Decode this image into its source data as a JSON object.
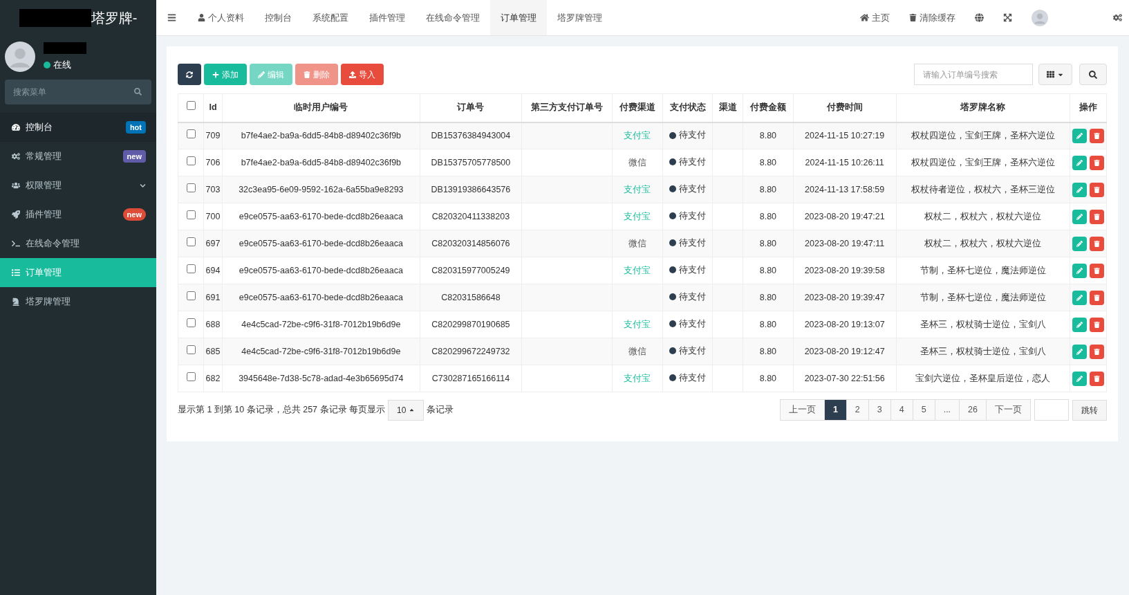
{
  "sidebar": {
    "logo_text": "塔罗牌-",
    "user_status": "在线",
    "search": {
      "placeholder": "搜索菜单"
    },
    "items": [
      {
        "label": "控制台",
        "selected": false,
        "badge": {
          "text": "hot",
          "color": "#0073b7",
          "kind": "square"
        }
      },
      {
        "label": "常规管理",
        "selected": false,
        "badge": {
          "text": "new",
          "color": "#605ca8",
          "kind": "square"
        }
      },
      {
        "label": "权限管理",
        "selected": false,
        "has_children": true
      },
      {
        "label": "插件管理",
        "selected": false,
        "badge": {
          "text": "new",
          "color": "#dd4b39",
          "kind": "pill"
        }
      },
      {
        "label": "在线命令管理",
        "selected": false
      },
      {
        "label": "订单管理",
        "selected": true
      },
      {
        "label": "塔罗牌管理",
        "selected": false
      }
    ]
  },
  "topbar": {
    "tabs": [
      {
        "label": "个人资料",
        "selected": false,
        "has_icon": true
      },
      {
        "label": "控制台",
        "selected": false
      },
      {
        "label": "系统配置",
        "selected": false
      },
      {
        "label": "插件管理",
        "selected": false
      },
      {
        "label": "在线命令管理",
        "selected": false
      },
      {
        "label": "订单管理",
        "selected": true
      },
      {
        "label": "塔罗牌管理",
        "selected": false
      }
    ],
    "home": "主页",
    "clear_cache": "清除缓存"
  },
  "toolbar": {
    "buttons": [
      {
        "kind": "refresh",
        "disabled": false
      },
      {
        "kind": "add",
        "label": "添加",
        "disabled": false
      },
      {
        "kind": "edit",
        "label": "编辑",
        "disabled": true
      },
      {
        "kind": "delete",
        "label": "删除",
        "disabled": true
      },
      {
        "kind": "import",
        "label": "导入",
        "disabled": false
      }
    ],
    "search": {
      "placeholder": "请输入订单编号搜索"
    }
  },
  "table": {
    "select_all_checked": false,
    "columns": [
      "Id",
      "临时用户编号",
      "订单号",
      "第三方支付订单号",
      "付费渠道",
      "支付状态",
      "渠道",
      "付费金额",
      "付费时间",
      "塔罗牌名称",
      "操作"
    ],
    "rows": [
      {
        "checked": false,
        "id": "709",
        "user": "b7fe4ae2-ba9a-6dd5-84b8-d89402c36f9b",
        "order": "DB15376384943004",
        "channel": {
          "text": "支付宝",
          "kind": "alipay"
        },
        "status": "待支付",
        "amount": "8.80",
        "time": "2024-11-15 10:27:19",
        "cards": "权杖四逆位，宝剑王牌，圣杯六逆位"
      },
      {
        "checked": false,
        "id": "706",
        "user": "b7fe4ae2-ba9a-6dd5-84b8-d89402c36f9b",
        "order": "DB15375705778500",
        "channel": {
          "text": "微信",
          "kind": "wechat"
        },
        "status": "待支付",
        "amount": "8.80",
        "time": "2024-11-15 10:26:11",
        "cards": "权杖四逆位，宝剑王牌，圣杯六逆位"
      },
      {
        "checked": false,
        "id": "703",
        "user": "32c3ea95-6e09-9592-162a-6a55ba9e8293",
        "order": "DB13919386643576",
        "channel": {
          "text": "支付宝",
          "kind": "alipay"
        },
        "status": "待支付",
        "amount": "8.80",
        "time": "2024-11-13 17:58:59",
        "cards": "权杖待者逆位，权杖六，圣杯三逆位"
      },
      {
        "checked": false,
        "id": "700",
        "user": "e9ce0575-aa63-6170-bede-dcd8b26eaaca",
        "order": "C820320411338203",
        "channel": {
          "text": "支付宝",
          "kind": "alipay"
        },
        "status": "待支付",
        "amount": "8.80",
        "time": "2023-08-20 19:47:21",
        "cards": "权杖二，权杖六，权杖六逆位"
      },
      {
        "checked": false,
        "id": "697",
        "user": "e9ce0575-aa63-6170-bede-dcd8b26eaaca",
        "order": "C820320314856076",
        "channel": {
          "text": "微信",
          "kind": "wechat"
        },
        "status": "待支付",
        "amount": "8.80",
        "time": "2023-08-20 19:47:11",
        "cards": "权杖二，权杖六，权杖六逆位"
      },
      {
        "checked": false,
        "id": "694",
        "user": "e9ce0575-aa63-6170-bede-dcd8b26eaaca",
        "order": "C820315977005249",
        "channel": {
          "text": "支付宝",
          "kind": "alipay"
        },
        "status": "待支付",
        "amount": "8.80",
        "time": "2023-08-20 19:39:58",
        "cards": "节制，圣杯七逆位，魔法师逆位"
      },
      {
        "checked": false,
        "id": "691",
        "user": "e9ce0575-aa63-6170-bede-dcd8b26eaaca",
        "order": "C82031586648",
        "status": "待支付",
        "amount": "8.80",
        "time": "2023-08-20 19:39:47",
        "cards": "节制，圣杯七逆位，魔法师逆位"
      },
      {
        "checked": false,
        "id": "688",
        "user": "4e4c5cad-72be-c9f6-31f8-7012b19b6d9e",
        "order": "C820299870190685",
        "channel": {
          "text": "支付宝",
          "kind": "alipay"
        },
        "status": "待支付",
        "amount": "8.80",
        "time": "2023-08-20 19:13:07",
        "cards": "圣杯三，权杖骑士逆位，宝剑八"
      },
      {
        "checked": false,
        "id": "685",
        "user": "4e4c5cad-72be-c9f6-31f8-7012b19b6d9e",
        "order": "C820299672249732",
        "channel": {
          "text": "微信",
          "kind": "wechat"
        },
        "status": "待支付",
        "amount": "8.80",
        "time": "2023-08-20 19:12:47",
        "cards": "圣杯三，权杖骑士逆位，宝剑八"
      },
      {
        "checked": false,
        "id": "682",
        "user": "3945648e-7d38-5c78-adad-4e3b65695d74",
        "order": "C730287165166114",
        "channel": {
          "text": "支付宝",
          "kind": "alipay"
        },
        "status": "待支付",
        "amount": "8.80",
        "time": "2023-07-30 22:51:56",
        "cards": "宝剑六逆位，圣杯皇后逆位，恋人"
      }
    ]
  },
  "footer": {
    "summary": "显示第 1 到第 10 条记录，总共 257 条记录 每页显示",
    "page_size": "10",
    "summary_end": "条记录",
    "pages": [
      {
        "label": "上一页",
        "selected": false
      },
      {
        "label": "1",
        "selected": true
      },
      {
        "label": "2",
        "selected": false
      },
      {
        "label": "3",
        "selected": false
      },
      {
        "label": "4",
        "selected": false
      },
      {
        "label": "5",
        "selected": false
      },
      {
        "label": "...",
        "selected": false
      },
      {
        "label": "26",
        "selected": false
      },
      {
        "label": "下一页",
        "selected": false
      }
    ],
    "jump": "跳转"
  }
}
